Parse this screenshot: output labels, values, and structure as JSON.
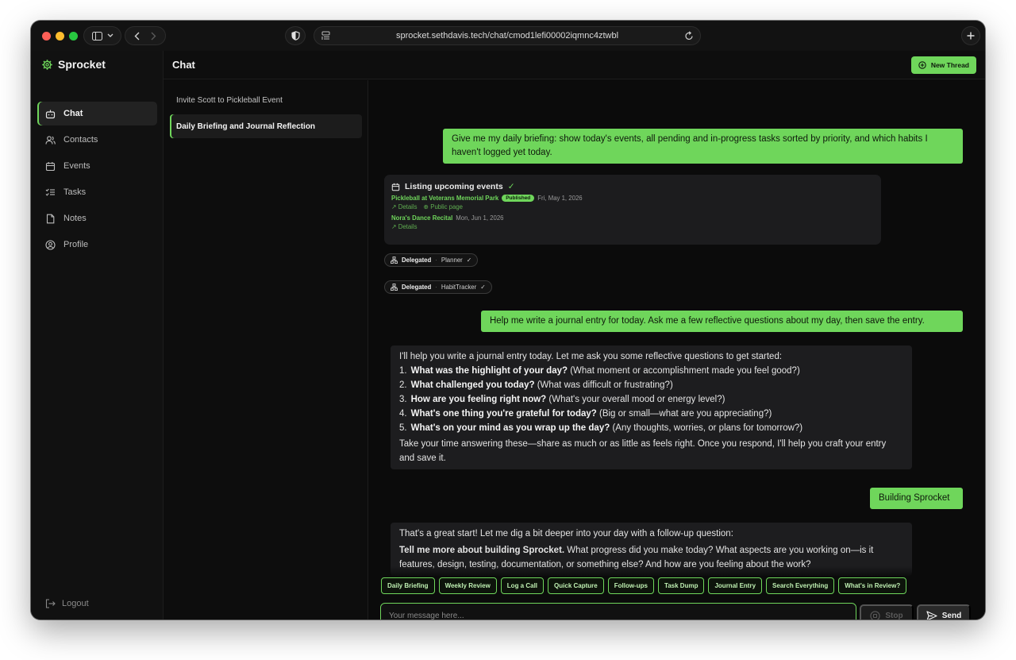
{
  "browser": {
    "url": "sprocket.sethdavis.tech/chat/cmod1lefi00002iqmnc4ztwbl"
  },
  "sidebar": {
    "brand": "Sprocket",
    "items": [
      {
        "label": "Chat",
        "icon": "bot-icon",
        "active": true
      },
      {
        "label": "Contacts",
        "icon": "users-icon"
      },
      {
        "label": "Events",
        "icon": "calendar-icon"
      },
      {
        "label": "Tasks",
        "icon": "list-checks-icon"
      },
      {
        "label": "Notes",
        "icon": "file-icon"
      },
      {
        "label": "Profile",
        "icon": "user-circle-icon"
      }
    ],
    "logout": "Logout"
  },
  "header": {
    "title": "Chat",
    "new_thread": "New Thread"
  },
  "threads": [
    {
      "title": "Invite Scott to Pickleball Event"
    },
    {
      "title": "Daily Briefing and Journal Reflection",
      "active": true
    }
  ],
  "messages": {
    "m1": "Give me my daily briefing: show today's events, all pending and in-progress tasks sorted by priority, and which habits I haven't logged yet today.",
    "tool": {
      "title": "Listing upcoming events",
      "ev1_title": "Pickleball at Veterans Memorial Park",
      "ev1_badge": "Published",
      "ev1_date": "Fri, May 1, 2026",
      "ev1_details": "Details",
      "ev1_public": "Public page",
      "ev2_title": "Nora's Dance Recital",
      "ev2_date": "Mon, Jun 1, 2026",
      "ev2_details": "Details"
    },
    "delegated_label": "Delegated",
    "deleg1_agent": "Planner",
    "deleg2_agent": "HabitTracker",
    "m2": "Help me write a journal entry for today. Ask me a few reflective questions about my day, then save the entry.",
    "ai1": {
      "intro": "I'll help you write a journal entry today. Let me ask you some reflective questions to get started:",
      "q1_num": "1.",
      "q1_bold": "What was the highlight of your day?",
      "q1_rest": "(What moment or accomplishment made you feel good?)",
      "q2_num": "2.",
      "q2_bold": "What challenged you today?",
      "q2_rest": "(What was difficult or frustrating?)",
      "q3_num": "3.",
      "q3_bold": "How are you feeling right now?",
      "q3_rest": "(What's your overall mood or energy level?)",
      "q4_num": "4.",
      "q4_bold": "What's one thing you're grateful for today?",
      "q4_rest": "(Big or small—what are you appreciating?)",
      "q5_num": "5.",
      "q5_bold": "What's on your mind as you wrap up the day?",
      "q5_rest": "(Any thoughts, worries, or plans for tomorrow?)",
      "outro": "Take your time answering these—share as much or as little as feels right. Once you respond, I'll help you craft your entry and save it."
    },
    "m3": "Building Sprocket",
    "ai2": {
      "line1": "That's a great start! Let me dig a bit deeper into your day with a follow-up question:",
      "bold": "Tell me more about building Sprocket.",
      "rest": "What progress did you make today? What aspects are you working on—is it features, design, testing, documentation, or something else? And how are you feeling about the work?"
    }
  },
  "quick_actions": [
    "Daily Briefing",
    "Weekly Review",
    "Log a Call",
    "Quick Capture",
    "Follow-ups",
    "Task Dump",
    "Journal Entry",
    "Search Everything",
    "What's in Review?"
  ],
  "composer": {
    "placeholder": "Your message here...",
    "stop": "Stop",
    "send": "Send"
  },
  "colors": {
    "accent": "#6fd65b",
    "background": "#0b0b0b",
    "panel": "#1d1d1f"
  }
}
